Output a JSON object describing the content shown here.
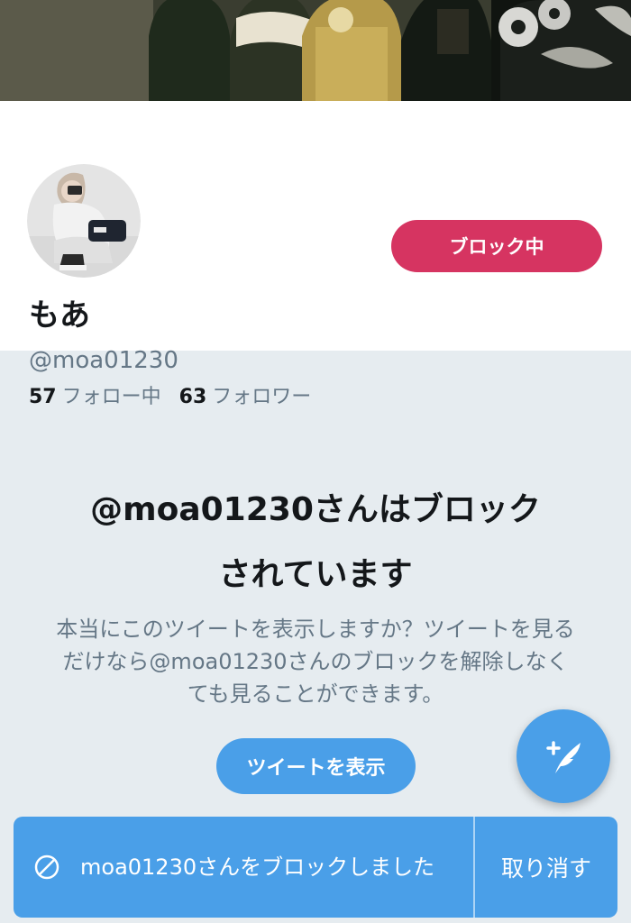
{
  "profile": {
    "display_name": "もあ",
    "handle": "@moa01230",
    "block_button_label": "ブロック中",
    "following_count": "57",
    "following_label": "フォロー中",
    "followers_count": "63",
    "followers_label": "フォロワー"
  },
  "blocked_notice": {
    "title_line1": "@moa01230さんはブロック",
    "title_line2": "されています",
    "description": "本当にこのツイートを表示しますか？ツイートを見るだけなら@moa01230さんのブロックを解除しなくても見ることができます。",
    "show_tweets_label": "ツイートを表示"
  },
  "toast": {
    "message": "moa01230さんをブロックしました",
    "undo_label": "取り消す"
  },
  "fab": {
    "icon": "compose-tweet-icon"
  },
  "colors": {
    "block_red": "#d63461",
    "twitter_blue": "#4a9fe8",
    "page_bg": "#e6ecf0",
    "secondary_text": "#657786"
  }
}
